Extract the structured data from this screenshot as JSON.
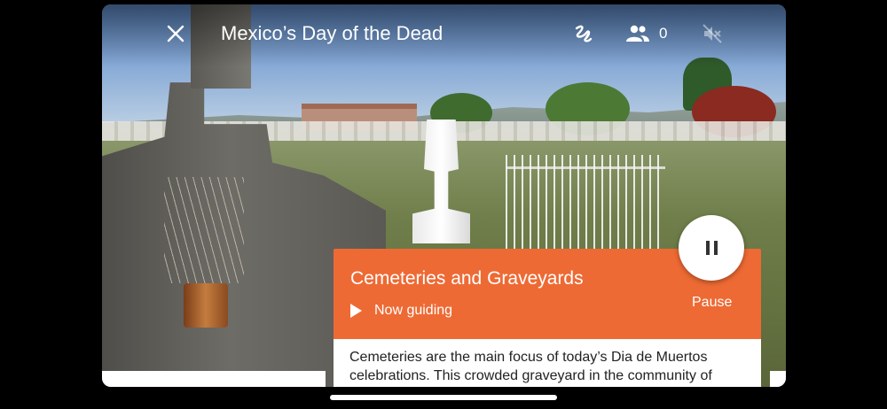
{
  "header": {
    "title": "Mexico’s Day of the Dead",
    "participant_count": "0",
    "icons": [
      "close-icon",
      "guide-squiggle-icon",
      "people-icon",
      "mute-icon"
    ]
  },
  "guide_card": {
    "title": "Cemeteries and Graveyards",
    "status": "Now guiding",
    "pause_label": "Pause"
  },
  "description": {
    "text": "Cemeteries are the main focus of today’s Dia de Muertos celebrations. This crowded graveyard in the community of Mixquic, on the outskirts of Mexico City, is home to many of"
  },
  "colors": {
    "accent": "#ee6a34",
    "background": "#000000"
  }
}
